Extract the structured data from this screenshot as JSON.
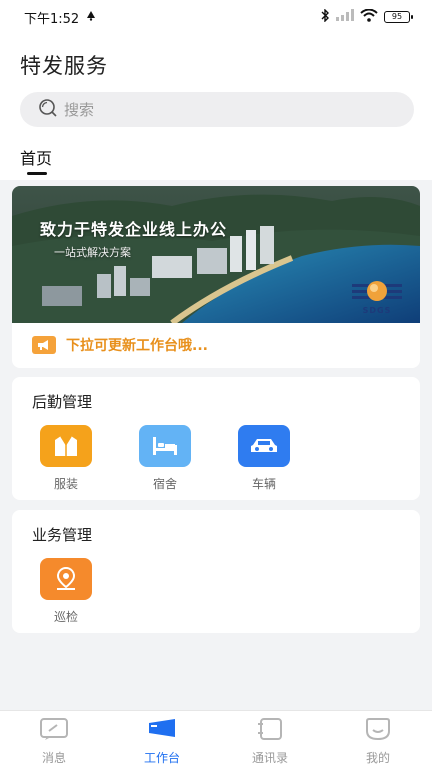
{
  "status_bar": {
    "time": "下午1:52",
    "battery": "95"
  },
  "header": {
    "title": "特发服务",
    "search_placeholder": "搜索",
    "tab": "首页"
  },
  "banner": {
    "title": "致力于特发企业线上办公",
    "subtitle": "一站式解决方案",
    "logo_text": "SDGS"
  },
  "notice": {
    "text": "下拉可更新工作台哦..."
  },
  "logistics": {
    "title": "后勤管理",
    "items": [
      {
        "label": "服装",
        "icon": "clothing-icon",
        "color": "#f5a21b"
      },
      {
        "label": "宿舍",
        "icon": "bed-icon",
        "color": "#63b3f5"
      },
      {
        "label": "车辆",
        "icon": "car-icon",
        "color": "#2f7cf0"
      }
    ]
  },
  "business": {
    "title": "业务管理",
    "items": [
      {
        "label": "巡检",
        "icon": "location-pin-icon",
        "color": "#f58a2c"
      }
    ]
  },
  "tabbar": {
    "items": [
      {
        "label": "消息",
        "icon": "message-icon",
        "active": false
      },
      {
        "label": "工作台",
        "icon": "workbench-icon",
        "active": true
      },
      {
        "label": "通讯录",
        "icon": "contacts-icon",
        "active": false
      },
      {
        "label": "我的",
        "icon": "profile-icon",
        "active": false
      }
    ],
    "active_color": "#1f6ff0",
    "inactive_color": "#999999"
  }
}
